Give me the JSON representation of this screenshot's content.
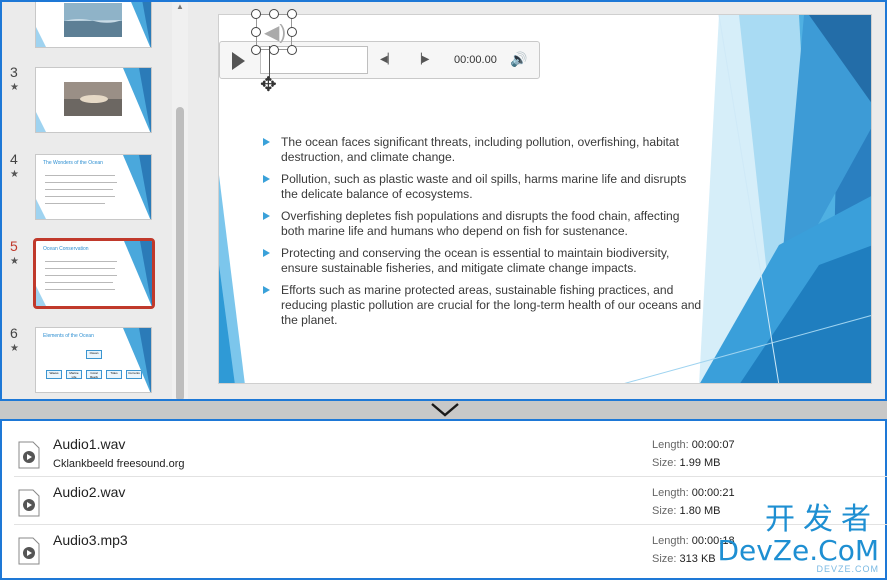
{
  "thumbnails": [
    {
      "num": "",
      "star": ""
    },
    {
      "num": "3",
      "star": "★"
    },
    {
      "num": "4",
      "star": "★",
      "title": "The Wonders of the Ocean"
    },
    {
      "num": "5",
      "star": "★",
      "title": "Ocean Conservation"
    },
    {
      "num": "6",
      "star": "★",
      "title": "Elements of the Ocean",
      "diagram_top": "Ocean",
      "diagram_items": [
        "Waves",
        "Marine Life",
        "Coral Reefs",
        "Tides",
        "Currents"
      ]
    }
  ],
  "player": {
    "time": "00:00.00"
  },
  "slide": {
    "bullets": [
      "The ocean faces significant threats, including pollution, overfishing, habitat destruction, and climate change.",
      "Pollution, such as plastic waste and oil spills, harms marine life and disrupts the delicate balance of ecosystems.",
      "Overfishing depletes fish populations and disrupts the food chain, affecting both marine life and humans who depend on fish for sustenance.",
      "Protecting and conserving the ocean is essential to maintain biodiversity, ensure sustainable fisheries, and mitigate climate change impacts.",
      "Efforts such as marine protected areas, sustainable fishing practices, and reducing plastic pollution are crucial for the long-term health of our oceans and the planet."
    ]
  },
  "files": [
    {
      "name": "Audio1.wav",
      "sub": "Cklankbeeld freesound.org",
      "length_label": "Length:",
      "length": "00:00:07",
      "size_label": "Size:",
      "size": "1.99 MB"
    },
    {
      "name": "Audio2.wav",
      "sub": "",
      "length_label": "Length:",
      "length": "00:00:21",
      "size_label": "Size:",
      "size": "1.80 MB"
    },
    {
      "name": "Audio3.mp3",
      "sub": "",
      "length_label": "Length:",
      "length": "00:00:18",
      "size_label": "Size:",
      "size": "313 KB"
    }
  ],
  "watermark": {
    "cn": "开发者",
    "en": "DevZe.CoM",
    "small": "DEVZE.COM"
  },
  "colors": {
    "accent": "#1e78d6",
    "slide_blue": "#3aa1d9",
    "active_slide": "#c0392b"
  }
}
